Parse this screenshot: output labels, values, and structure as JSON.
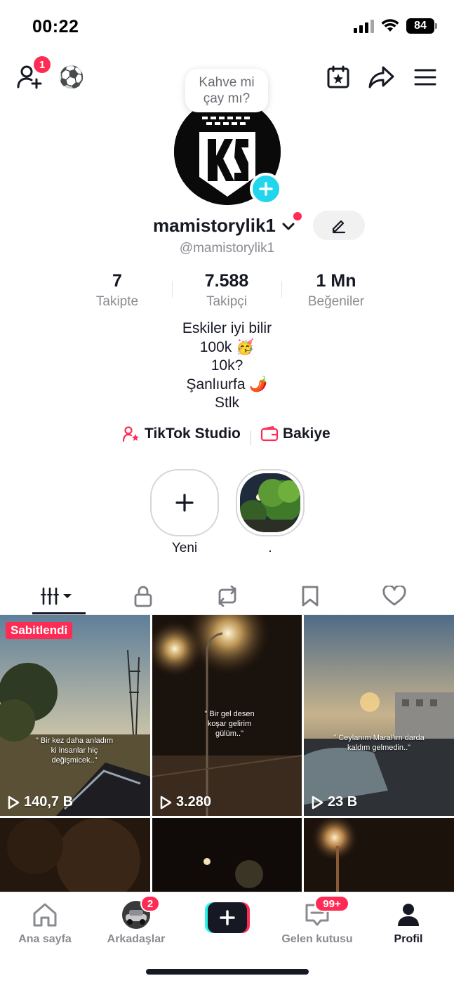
{
  "status_bar": {
    "time": "00:22",
    "battery": "84"
  },
  "top_bar": {
    "notification_count": "1",
    "emoji": "⚽"
  },
  "profile": {
    "note_line1": "Kahve mi",
    "note_line2": "çay mı?",
    "username": "mamistorylik1",
    "handle": "@mamistorylik1",
    "stats": [
      {
        "value": "7",
        "label": "Takipte"
      },
      {
        "value": "7.588",
        "label": "Takipçi"
      },
      {
        "value": "1 Mn",
        "label": "Beğeniler"
      }
    ],
    "bio": [
      "Eskiler iyi bilir",
      "100k 🥳",
      "10k?",
      "Şanlıurfa 🌶️",
      "Stlk"
    ],
    "links": {
      "studio": "TikTok Studio",
      "balance": "Bakiye"
    }
  },
  "highlights": [
    {
      "label": "Yeni"
    },
    {
      "label": "."
    }
  ],
  "videos": [
    {
      "views": "140,7 B",
      "pinned": "Sabitlendi",
      "caption": "\" Bir kez daha anladım ki insanlar hiç değişmicek..\""
    },
    {
      "views": "3.280",
      "caption": "\" Bir gel desen koşar gelirim gülüm..\""
    },
    {
      "views": "23 B",
      "caption": "\" Ceylanım Maral'ım darda kaldım gelmedin..\""
    }
  ],
  "bottom_nav": {
    "home": "Ana sayfa",
    "friends": "Arkadaşlar",
    "friends_badge": "2",
    "inbox": "Gelen kutusu",
    "inbox_badge": "99+",
    "profile": "Profil"
  },
  "colors": {
    "accent": "#fe2c55",
    "cyan": "#20d5ec",
    "text": "#161823",
    "muted": "#8a8b91"
  }
}
